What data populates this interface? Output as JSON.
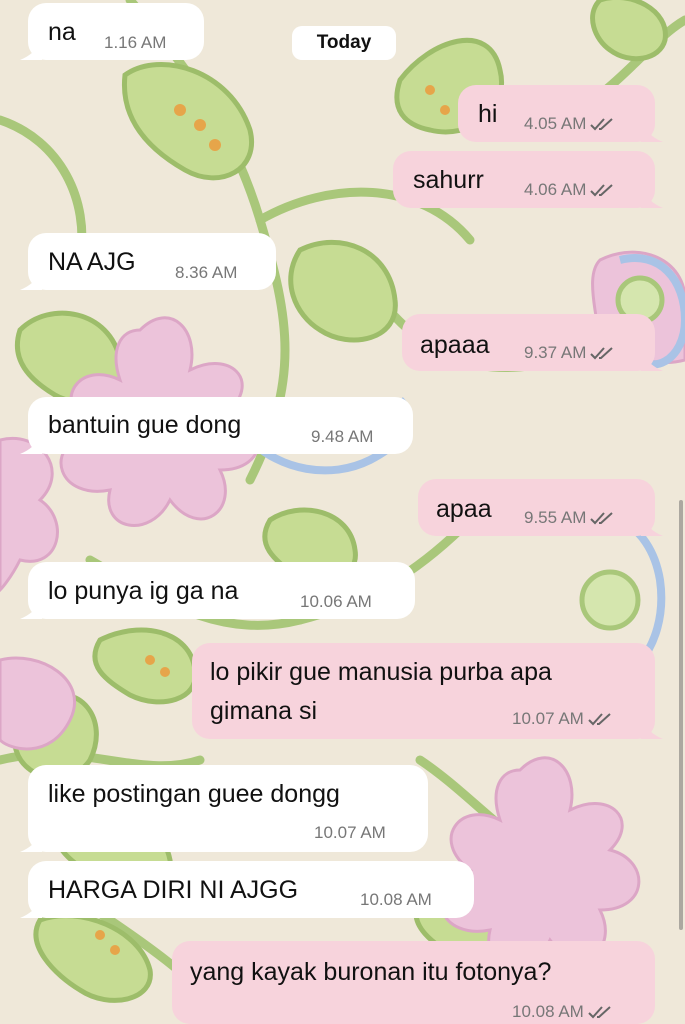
{
  "date_separator": "Today",
  "messages": [
    {
      "dir": "in",
      "text": "na",
      "time": "1.16 AM"
    },
    {
      "dir": "out",
      "text": "hi",
      "time": "4.05 AM"
    },
    {
      "dir": "out",
      "text": "sahurr",
      "time": "4.06 AM"
    },
    {
      "dir": "in",
      "text": "NA AJG",
      "time": "8.36 AM"
    },
    {
      "dir": "out",
      "text": "apaaa",
      "time": "9.37 AM"
    },
    {
      "dir": "in",
      "text": "bantuin gue dong",
      "time": "9.48 AM"
    },
    {
      "dir": "out",
      "text": "apaa",
      "time": "9.55 AM"
    },
    {
      "dir": "in",
      "text": "lo punya ig ga na",
      "time": "10.06 AM"
    },
    {
      "dir": "out",
      "text_lines": [
        "lo pikir gue manusia purba apa",
        "gimana si"
      ],
      "time": "10.07 AM"
    },
    {
      "dir": "in",
      "text": "like postingan guee dongg",
      "time": "10.07 AM"
    },
    {
      "dir": "in",
      "text": "HARGA DIRI NI AJGG",
      "time": "10.08 AM"
    },
    {
      "dir": "out",
      "text": "yang kayak buronan itu fotonya?",
      "time": "10.08 AM"
    }
  ],
  "colors": {
    "incoming_bubble": "#ffffff",
    "outgoing_bubble": "#f7d3dc",
    "wallpaper_base": "#efe8d9",
    "leaf_green": "#a9c77a",
    "flower_pink": "#eab9d3",
    "accent_blue": "#a9c3e6"
  },
  "icons": {
    "read_receipt": "double-check-icon"
  }
}
